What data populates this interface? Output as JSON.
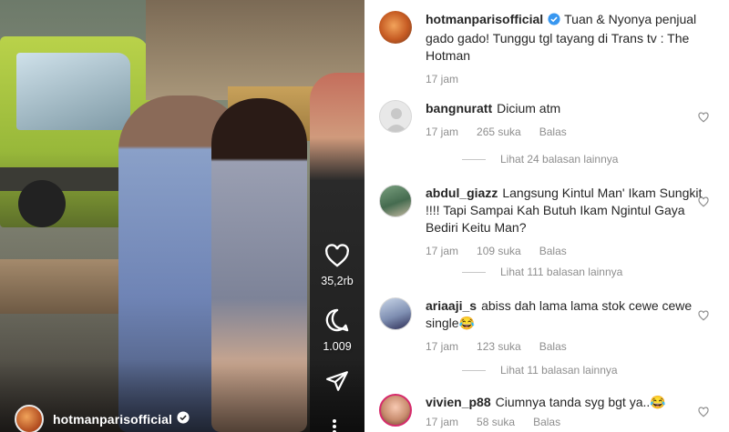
{
  "video": {
    "username": "hotmanparisofficial",
    "likes_count": "35,2rb",
    "comments_count": "1.009"
  },
  "caption": {
    "username": "hotmanparisofficial",
    "text": "Tuan & Nyonya penjual gado gado! Tunggu tgl tayang di Trans tv : The Hotman",
    "time": "17 jam"
  },
  "comments": [
    {
      "username": "bangnuratt",
      "text": "Dicium atm",
      "time": "17 jam",
      "likes": "265 suka",
      "reply": "Balas",
      "more_replies": "Lihat 24 balasan lainnya"
    },
    {
      "username": "abdul_giazz",
      "text": "Langsung Kintul Man' Ikam Sungkit !!!! Tapi Sampai Kah Butuh Ikam Ngintul Gaya Bediri Keitu Man?",
      "time": "17 jam",
      "likes": "109 suka",
      "reply": "Balas",
      "more_replies": "Lihat 111 balasan lainnya"
    },
    {
      "username": "ariaaji_s",
      "text": "abiss dah lama lama stok cewe cewe single😂",
      "time": "17 jam",
      "likes": "123 suka",
      "reply": "Balas",
      "more_replies": "Lihat 11 balasan lainnya"
    },
    {
      "username": "vivien_p88",
      "text": "Ciumnya tanda syg bgt ya..😂",
      "time": "17 jam",
      "likes": "58 suka",
      "reply": "Balas"
    }
  ],
  "icons": {
    "like": "heart-icon",
    "comment": "comment-bubble-icon",
    "share": "share-send-icon",
    "verified": "verified-badge-icon",
    "more": "more-ellipsis-icon"
  },
  "colors": {
    "verified": "#3897f0",
    "muted_text": "#8e8e8e",
    "text": "#262626"
  }
}
